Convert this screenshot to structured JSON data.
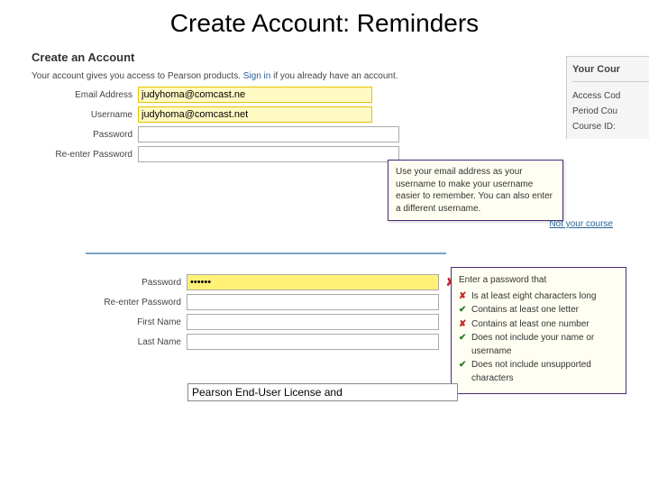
{
  "slide": {
    "title": "Create Account: Reminders"
  },
  "sec1": {
    "heading": "Create an Account",
    "desc_pre": "Your account gives you access to Pearson products. ",
    "signin_label": "Sign in",
    "desc_post": " if you already have an account.",
    "labels": {
      "email": "Email Address",
      "username": "Username",
      "password": "Password",
      "reenter": "Re-enter Password"
    },
    "values": {
      "email": "judyhoma@comcast.ne",
      "username": "judyhoma@comcast.net"
    }
  },
  "sidebar1": {
    "title": "Your Cour",
    "items": [
      "Access Cod",
      "Period Cou",
      "Course ID:"
    ]
  },
  "tooltip": {
    "text": "Use your email address as your username to make your username easier to remember. You can also enter a different username."
  },
  "not_your_course": "Not your course",
  "sec2": {
    "labels": {
      "password": "Password",
      "reenter": "Re-enter Password",
      "first": "First Name",
      "last": "Last Name"
    },
    "values": {
      "password": "••••••"
    }
  },
  "reqs": {
    "lead": "Enter a password that",
    "items": [
      {
        "ok": false,
        "text": "Is at least eight characters long"
      },
      {
        "ok": true,
        "text": "Contains at least one letter"
      },
      {
        "ok": false,
        "text": "Contains at least one number"
      },
      {
        "ok": true,
        "text": "Does not include your name or username"
      },
      {
        "ok": true,
        "text": "Does not include unsupported characters"
      }
    ]
  },
  "license": {
    "value": "Pearson End-User License and"
  },
  "marks": {
    "ok": "✔",
    "no": "✘"
  }
}
